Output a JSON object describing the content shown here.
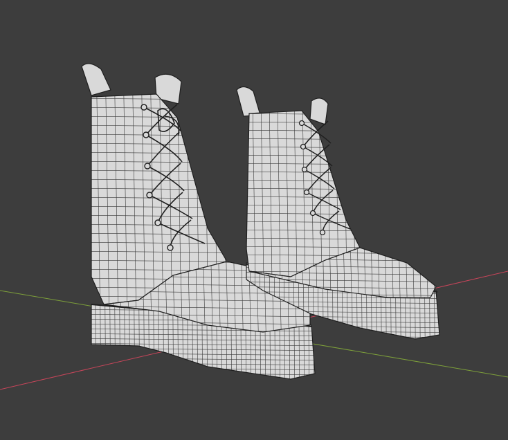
{
  "viewport": {
    "background": "#3d3d3d",
    "shading": "solid",
    "overlay": "wireframe",
    "mesh_color": "#d9d9d9",
    "wire_color": "#1f1f1f",
    "axes": {
      "x_axis_color": "#c8455a",
      "y_axis_color": "#7ea13a"
    }
  },
  "objects": [
    {
      "name": "boot-left",
      "type": "mesh"
    },
    {
      "name": "boot-right",
      "type": "mesh"
    }
  ]
}
